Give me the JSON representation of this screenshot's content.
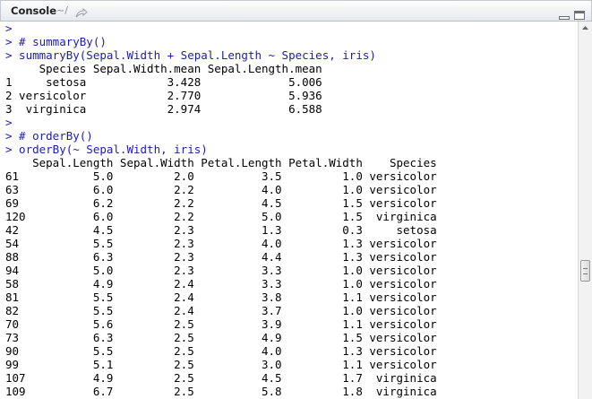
{
  "header": {
    "title": "Console",
    "path": "~/"
  },
  "console": {
    "lines": [
      {
        "kind": "in",
        "text": ">"
      },
      {
        "kind": "in",
        "text": "> # summaryBy()"
      },
      {
        "kind": "in",
        "text": "> summaryBy(Sepal.Width + Sepal.Length ~ Species, iris)"
      },
      {
        "kind": "out",
        "text": "     Species Sepal.Width.mean Sepal.Length.mean"
      },
      {
        "kind": "out",
        "text": "1     setosa            3.428             5.006"
      },
      {
        "kind": "out",
        "text": "2 versicolor            2.770             5.936"
      },
      {
        "kind": "out",
        "text": "3  virginica            2.974             6.588"
      },
      {
        "kind": "in",
        "text": ">"
      },
      {
        "kind": "in",
        "text": "> # orderBy()"
      },
      {
        "kind": "in",
        "text": "> orderBy(~ Sepal.Width, iris)"
      },
      {
        "kind": "out",
        "text": "    Sepal.Length Sepal.Width Petal.Length Petal.Width    Species"
      },
      {
        "kind": "out",
        "text": "61           5.0         2.0          3.5         1.0 versicolor"
      },
      {
        "kind": "out",
        "text": "63           6.0         2.2          4.0         1.0 versicolor"
      },
      {
        "kind": "out",
        "text": "69           6.2         2.2          4.5         1.5 versicolor"
      },
      {
        "kind": "out",
        "text": "120          6.0         2.2          5.0         1.5  virginica"
      },
      {
        "kind": "out",
        "text": "42           4.5         2.3          1.3         0.3     setosa"
      },
      {
        "kind": "out",
        "text": "54           5.5         2.3          4.0         1.3 versicolor"
      },
      {
        "kind": "out",
        "text": "88           6.3         2.3          4.4         1.3 versicolor"
      },
      {
        "kind": "out",
        "text": "94           5.0         2.3          3.3         1.0 versicolor"
      },
      {
        "kind": "out",
        "text": "58           4.9         2.4          3.3         1.0 versicolor"
      },
      {
        "kind": "out",
        "text": "81           5.5         2.4          3.8         1.1 versicolor"
      },
      {
        "kind": "out",
        "text": "82           5.5         2.4          3.7         1.0 versicolor"
      },
      {
        "kind": "out",
        "text": "70           5.6         2.5          3.9         1.1 versicolor"
      },
      {
        "kind": "out",
        "text": "73           6.3         2.5          4.9         1.5 versicolor"
      },
      {
        "kind": "out",
        "text": "90           5.5         2.5          4.0         1.3 versicolor"
      },
      {
        "kind": "out",
        "text": "99           5.1         2.5          3.0         1.1 versicolor"
      },
      {
        "kind": "out",
        "text": "107          4.9         2.5          4.5         1.7  virginica"
      },
      {
        "kind": "out",
        "text": "109          6.7         2.5          5.8         1.8  virginica"
      }
    ]
  },
  "icons": {
    "go_to_directory": "arrow-icon",
    "minimize": "minimize-icon",
    "maximize": "maximize-icon"
  },
  "colors": {
    "input_text": "#1b1bb5",
    "output_text": "#000000"
  }
}
